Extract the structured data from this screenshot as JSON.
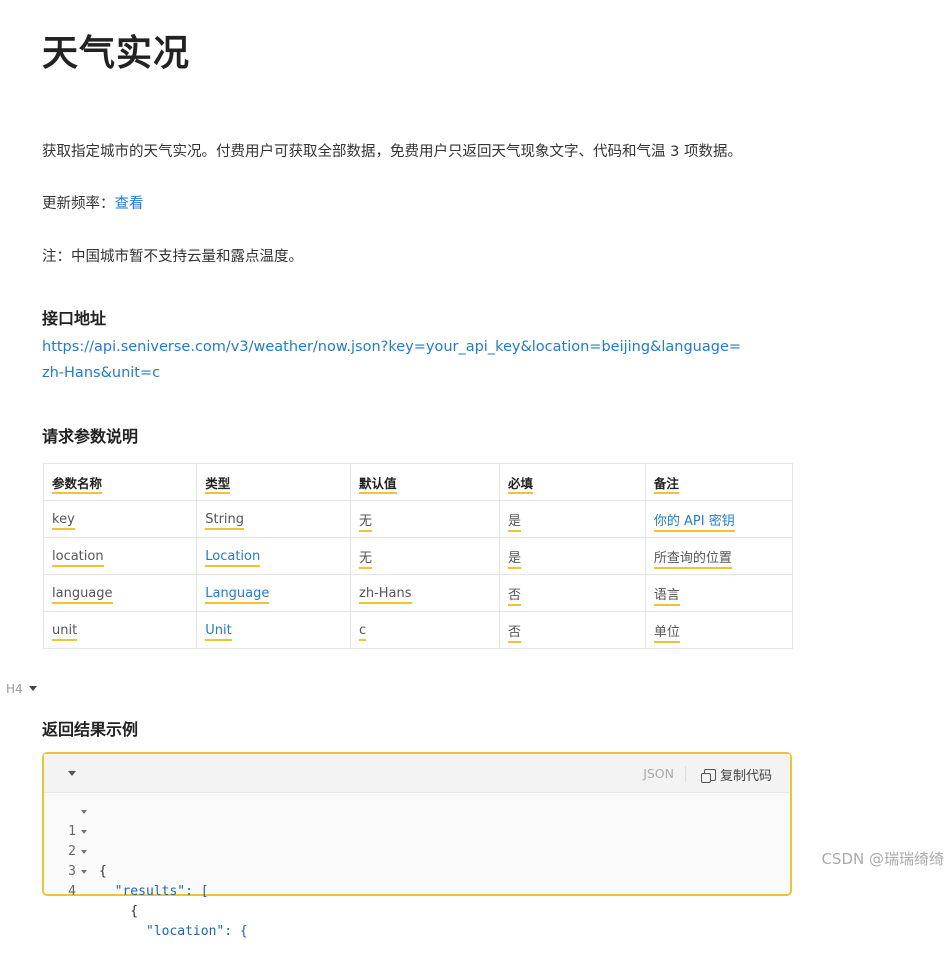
{
  "title": "天气实况",
  "description": "获取指定城市的天气实况。付费用户可获取全部数据，免费用户只返回天气现象文字、代码和气温 3 项数据。",
  "update_freq": {
    "label": "更新频率：",
    "link": "查看"
  },
  "note": "注：中国城市暂不支持云量和露点温度。",
  "api_section": {
    "heading": "接口地址",
    "url": "https://api.seniverse.com/v3/weather/now.json?key=your_api_key&location=beijing&language=zh-Hans&unit=c"
  },
  "params_section": {
    "heading": "请求参数说明",
    "columns": [
      "参数名称",
      "类型",
      "默认值",
      "必填",
      "备注"
    ],
    "rows": [
      [
        "key",
        "String",
        "无",
        "是",
        "你的 API 密钥"
      ],
      [
        "location",
        "Location",
        "无",
        "是",
        "所查询的位置"
      ],
      [
        "language",
        "Language",
        "zh-Hans",
        "否",
        "语言"
      ],
      [
        "unit",
        "Unit",
        "c",
        "否",
        "单位"
      ]
    ]
  },
  "heading_marker": "H4",
  "result_section": {
    "heading": "返回结果示例",
    "code_lang": "JSON",
    "copy_label": "复制代码",
    "lines": [
      {
        "num": "1",
        "text": "{"
      },
      {
        "num": "2",
        "text": "  \"results\": ["
      },
      {
        "num": "3",
        "text": "    {"
      },
      {
        "num": "4",
        "text": "      \"location\": {"
      }
    ]
  },
  "watermark": "CSDN @瑞瑞绮绮",
  "colors": {
    "link": "#1e7bd6",
    "accent_underline": "#f1c232"
  }
}
